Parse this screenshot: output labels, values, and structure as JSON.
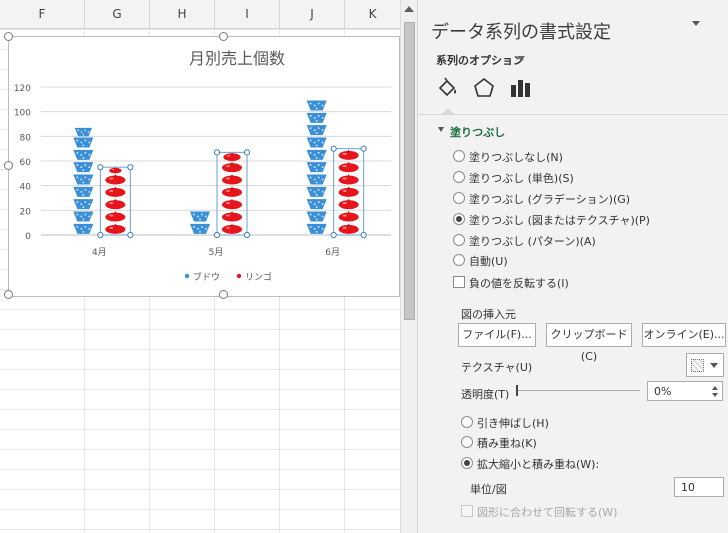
{
  "sheet": {
    "columns": [
      "F",
      "G",
      "H",
      "I",
      "J",
      "K"
    ]
  },
  "chart_data": {
    "type": "bar",
    "title": "月別売上個数",
    "categories": [
      "4月",
      "5月",
      "6月"
    ],
    "series": [
      {
        "name": "ブドウ",
        "values": [
          87,
          20,
          110
        ],
        "color": "#3a8fd6",
        "icon": "grape-icon"
      },
      {
        "name": "リンゴ",
        "values": [
          55,
          67,
          70
        ],
        "color": "#e8141b",
        "icon": "apple-icon"
      }
    ],
    "yticks": [
      "0",
      "20",
      "40",
      "60",
      "80",
      "100",
      "120"
    ],
    "ylim": [
      0,
      120
    ],
    "grid": true,
    "legend_position": "bottom"
  },
  "pane": {
    "title": "データ系列の書式設定",
    "series_options": "系列のオプション",
    "tabs": [
      "fill-line-icon",
      "effects-icon",
      "series-options-icon"
    ],
    "section": "塗りつぶし",
    "fill_options": [
      {
        "label": "塗りつぶしなし(N)",
        "selected": false
      },
      {
        "label": "塗りつぶし (単色)(S)",
        "selected": false
      },
      {
        "label": "塗りつぶし (グラデーション)(G)",
        "selected": false
      },
      {
        "label": "塗りつぶし (図またはテクスチャ)(P)",
        "selected": true
      },
      {
        "label": "塗りつぶし (パターン)(A)",
        "selected": false
      },
      {
        "label": "自動(U)",
        "selected": false
      }
    ],
    "invert_label": "負の値を反転する(I)",
    "insert_from": "図の挿入元",
    "btn_file": "ファイル(F)...",
    "btn_clipboard": "クリップボード(C)",
    "btn_online": "オンライン(E)...",
    "texture_label": "テクスチャ(U)",
    "transparency_label": "透明度(T)",
    "transparency_value": "0%",
    "transparency_level": 0,
    "stack_options": [
      {
        "label": "引き伸ばし(H)",
        "selected": false
      },
      {
        "label": "積み重ね(K)",
        "selected": false
      },
      {
        "label": "拡大縮小と積み重ね(W):",
        "selected": true
      }
    ],
    "unit_label": "単位/図",
    "unit_value": "10",
    "rotate_label": "図形に合わせて回転する(W)"
  }
}
